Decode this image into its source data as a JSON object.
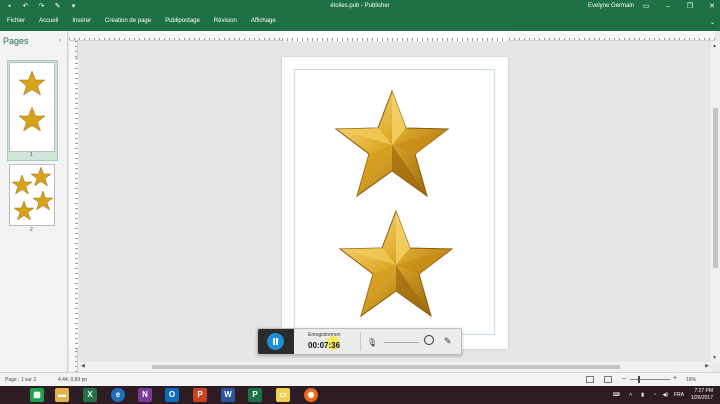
{
  "window": {
    "title": "étoiles.pub - Publisher",
    "user": "Evelyne Germain"
  },
  "ribbon": {
    "tabs": [
      "Fichier",
      "Accueil",
      "Insérer",
      "Création de page",
      "Publipostage",
      "Révision",
      "Affichage"
    ]
  },
  "pages_pane": {
    "heading": "Pages",
    "pages": [
      "1",
      "2"
    ]
  },
  "recorder": {
    "label": "Enregistremen",
    "time": "00:07:36"
  },
  "statusbar": {
    "page_info": "Page : 1 sur 2",
    "position": "4,44, 0,60 po",
    "zoom": "16%"
  },
  "taskbar": {
    "language": "FRA",
    "time": "7:27 PM",
    "date": "1/26/2017"
  },
  "colors": {
    "accent": "#1e7145",
    "star_gold": "#d9a21c"
  }
}
